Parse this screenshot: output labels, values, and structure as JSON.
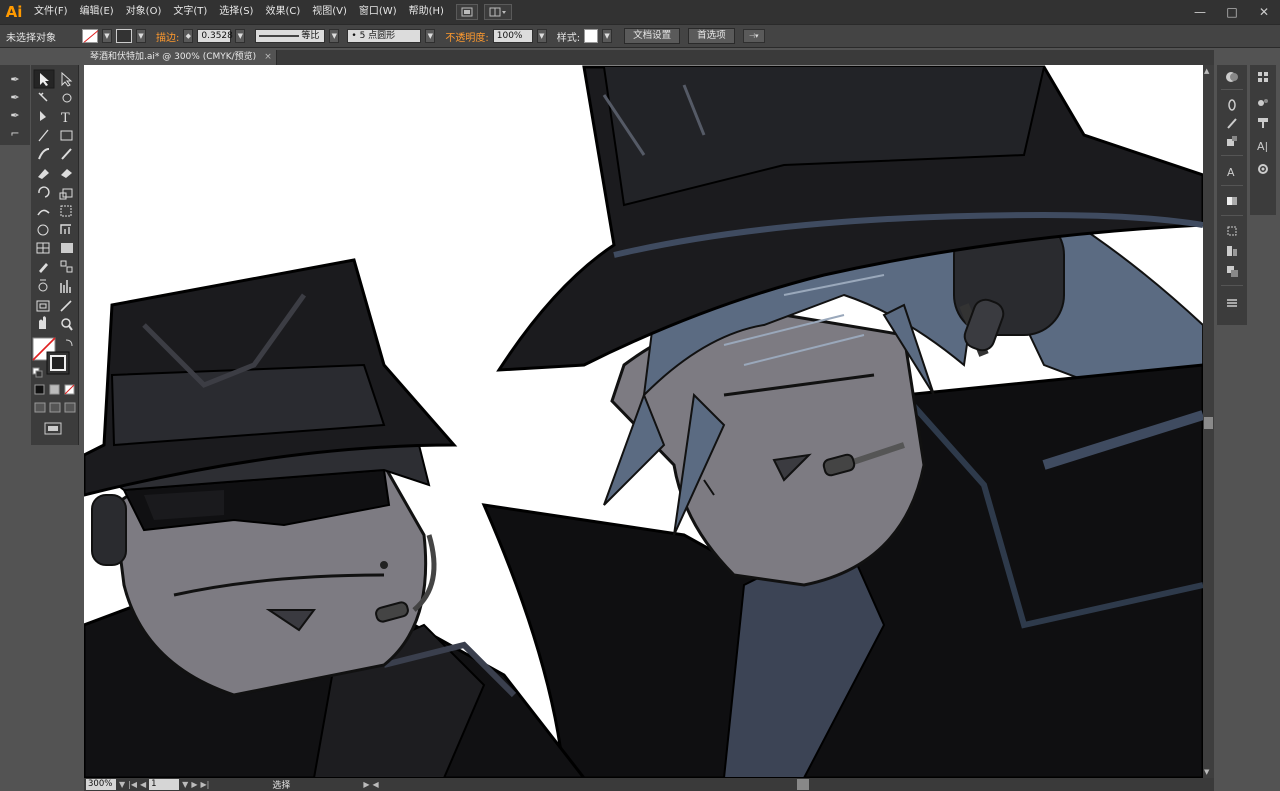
{
  "app": {
    "logo": "Ai"
  },
  "menu": [
    "文件(F)",
    "编辑(E)",
    "对象(O)",
    "文字(T)",
    "选择(S)",
    "效果(C)",
    "视图(V)",
    "窗口(W)",
    "帮助(H)"
  ],
  "controlbar": {
    "selection_status": "未选择对象",
    "stroke_label": "描边:",
    "stroke_value": "0.3528",
    "stroke_style": "等比",
    "brush": "5 点圆形",
    "opacity_label": "不透明度:",
    "opacity_value": "100%",
    "style_label": "样式:",
    "doc_setup_button": "文档设置",
    "prefs_button": "首选项"
  },
  "document": {
    "tab_title": "琴酒和伏特加.ai* @ 300% (CMYK/预览)",
    "tab_close": "×"
  },
  "status": {
    "zoom": "300%",
    "page": "1",
    "tool": "选择"
  },
  "icons": {
    "logo": "illustrator-logo",
    "tools": [
      "selection-tool",
      "direct-selection-tool",
      "magic-wand-tool",
      "lasso-tool",
      "pen-tool",
      "type-tool",
      "line-tool",
      "rectangle-tool",
      "paintbrush-tool",
      "pencil-tool",
      "blob-brush-tool",
      "eraser-tool",
      "rotate-tool",
      "scale-tool",
      "warp-tool",
      "free-transform-tool",
      "shape-builder-tool",
      "perspective-tool",
      "mesh-tool",
      "gradient-tool",
      "eyedropper-tool",
      "blend-tool",
      "symbol-sprayer-tool",
      "graph-tool",
      "artboard-tool",
      "slice-tool",
      "hand-tool",
      "zoom-tool"
    ]
  },
  "colors": {
    "accent": "#ff9a00",
    "hat": "#1b1b1e",
    "skin": "#7d7b82",
    "hair": "#5c6a80",
    "coat": "#0f0f11"
  }
}
